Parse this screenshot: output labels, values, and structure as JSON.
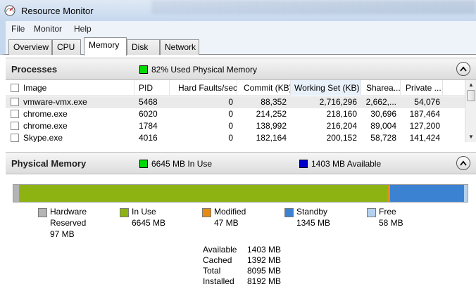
{
  "window": {
    "title": "Resource Monitor"
  },
  "menu": [
    "File",
    "Monitor",
    "Help"
  ],
  "tabs": [
    {
      "label": "Overview",
      "active": false
    },
    {
      "label": "CPU",
      "active": false
    },
    {
      "label": "Memory",
      "active": true
    },
    {
      "label": "Disk",
      "active": false
    },
    {
      "label": "Network",
      "active": false
    }
  ],
  "processes": {
    "title": "Processes",
    "badge": "82% Used Physical Memory",
    "badge_color": "#00d800",
    "columns": [
      "Image",
      "PID",
      "Hard Faults/sec",
      "Commit (KB)",
      "Working Set (KB)",
      "Sharea...",
      "Private ..."
    ],
    "rows": [
      [
        "vmware-vmx.exe",
        "5468",
        "0",
        "88,352",
        "2,716,296",
        "2,662,...",
        "54,076"
      ],
      [
        "chrome.exe",
        "6020",
        "0",
        "214,252",
        "218,160",
        "30,696",
        "187,464"
      ],
      [
        "chrome.exe",
        "1784",
        "0",
        "138,992",
        "216,204",
        "89,004",
        "127,200"
      ],
      [
        "Skype.exe",
        "4016",
        "0",
        "182,164",
        "200,152",
        "58,728",
        "141,424"
      ]
    ]
  },
  "physical_memory": {
    "title": "Physical Memory",
    "in_use_label": "6645 MB In Use",
    "available_label": "1403 MB Available",
    "in_use_color": "#00d800",
    "available_color": "#0000c8",
    "segments": [
      {
        "name": "Hardware Reserved",
        "label_line1": "Hardware",
        "label_line2": "Reserved",
        "value": "97 MB",
        "mb": 97,
        "color": "#b4b4b4"
      },
      {
        "name": "In Use",
        "label_line1": "In Use",
        "label_line2": "",
        "value": "6645 MB",
        "mb": 6645,
        "color": "#8cb312"
      },
      {
        "name": "Modified",
        "label_line1": "Modified",
        "label_line2": "",
        "value": "47 MB",
        "mb": 47,
        "color": "#e68c14"
      },
      {
        "name": "Standby",
        "label_line1": "Standby",
        "label_line2": "",
        "value": "1345 MB",
        "mb": 1345,
        "color": "#3c82d2"
      },
      {
        "name": "Free",
        "label_line1": "Free",
        "label_line2": "",
        "value": "58 MB",
        "mb": 58,
        "color": "#b4d2f0"
      }
    ],
    "summary": [
      {
        "key": "Available",
        "value": "1403 MB"
      },
      {
        "key": "Cached",
        "value": "1392 MB"
      },
      {
        "key": "Total",
        "value": "8095 MB"
      },
      {
        "key": "Installed",
        "value": "8192 MB"
      }
    ]
  }
}
